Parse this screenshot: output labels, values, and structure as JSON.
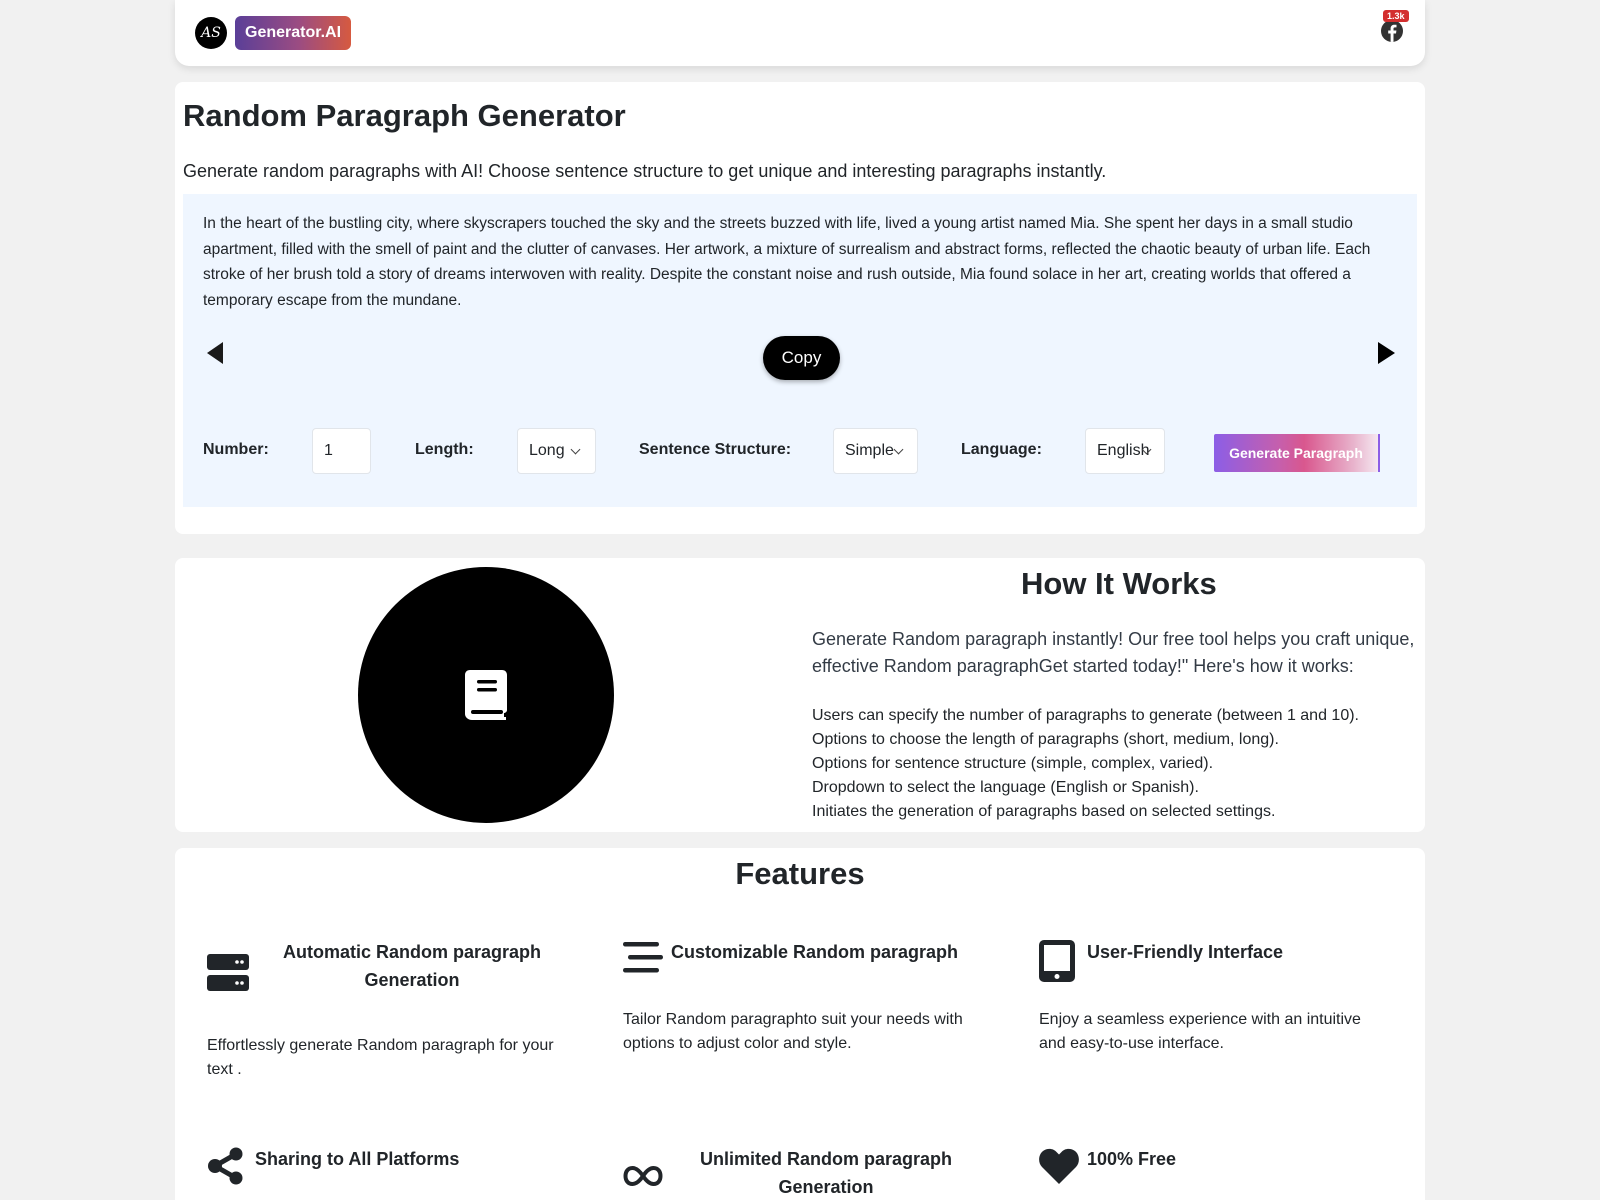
{
  "navbar": {
    "avatar_initials": "AS",
    "brand": "Generator.AI",
    "facebook_count": "1.3k"
  },
  "generator": {
    "title": "Random Paragraph Generator",
    "description": "Generate random paragraphs with AI! Choose sentence structure to get unique and interesting paragraphs instantly.",
    "paragraph": "In the heart of the bustling city, where skyscrapers touched the sky and the streets buzzed with life, lived a young artist named Mia. She spent her days in a small studio apartment, filled with the smell of paint and the clutter of canvases. Her artwork, a mixture of surrealism and abstract forms, reflected the chaotic beauty of urban life. Each stroke of her brush told a story of dreams interwoven with reality. Despite the constant noise and rush outside, Mia found solace in her art, creating worlds that offered a temporary escape from the mundane.",
    "copy_label": "Copy",
    "controls": {
      "number_label": "Number:",
      "number_value": "1",
      "length_label": "Length:",
      "length_value": "Long",
      "structure_label": "Sentence Structure:",
      "structure_value": "Simple",
      "language_label": "Language:",
      "language_value": "English",
      "generate_label": "Generate Paragraph"
    }
  },
  "how_it_works": {
    "icon": "book-icon",
    "title": "How It Works",
    "intro": "Generate Random paragraph instantly! Our free tool helps you craft unique, effective Random paragraphGet started today!\" Here's how it works:",
    "steps": [
      "Users can specify the number of paragraphs to generate (between 1 and 10).",
      "Options to choose the length of paragraphs (short, medium, long).",
      "Options for sentence structure (simple, complex, varied).",
      "Dropdown to select the language (English or Spanish).",
      "Initiates the generation of paragraphs based on selected settings."
    ]
  },
  "features": {
    "title": "Features",
    "items": [
      {
        "icon": "server-icon",
        "title": "Automatic Random paragraph Generation",
        "desc": "Effortlessly generate Random paragraph for your text ."
      },
      {
        "icon": "align-lines-icon",
        "title": "Customizable Random paragraph",
        "desc": "Tailor Random paragraphto suit your needs with options to adjust color and style."
      },
      {
        "icon": "tablet-icon",
        "title": "User-Friendly Interface",
        "desc": "Enjoy a seamless experience with an intuitive and easy-to-use interface."
      },
      {
        "icon": "share-icon",
        "title": "Sharing to All Platforms",
        "desc": ""
      },
      {
        "icon": "infinity-icon",
        "title": "Unlimited Random paragraph Generation",
        "desc": ""
      },
      {
        "icon": "heart-icon",
        "title": "100% Free",
        "desc": ""
      }
    ]
  }
}
